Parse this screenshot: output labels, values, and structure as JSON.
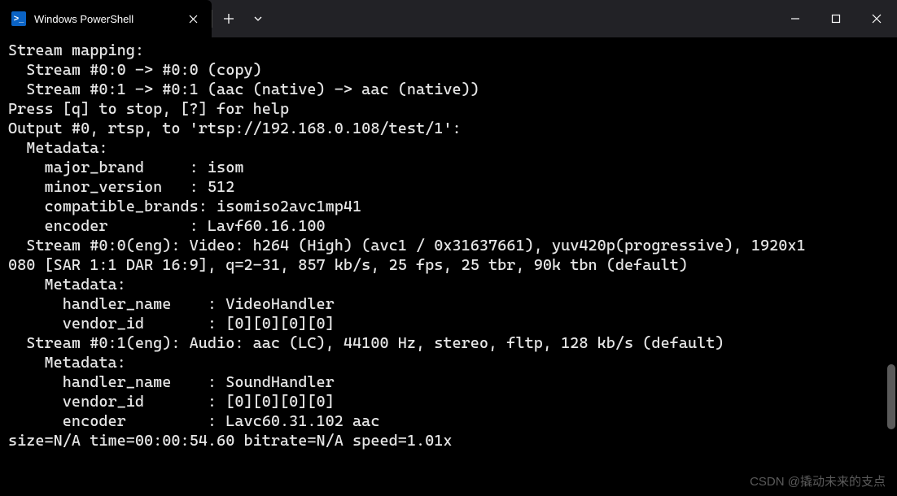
{
  "titlebar": {
    "tab_title": "Windows PowerShell",
    "ps_glyph": ">_"
  },
  "terminal": {
    "lines": [
      "Stream mapping:",
      "  Stream #0:0 -> #0:0 (copy)",
      "  Stream #0:1 -> #0:1 (aac (native) -> aac (native))",
      "Press [q] to stop, [?] for help",
      "Output #0, rtsp, to 'rtsp://192.168.0.108/test/1':",
      "  Metadata:",
      "    major_brand     : isom",
      "    minor_version   : 512",
      "    compatible_brands: isomiso2avc1mp41",
      "    encoder         : Lavf60.16.100",
      "  Stream #0:0(eng): Video: h264 (High) (avc1 / 0x31637661), yuv420p(progressive), 1920x1",
      "080 [SAR 1:1 DAR 16:9], q=2-31, 857 kb/s, 25 fps, 25 tbr, 90k tbn (default)",
      "    Metadata:",
      "      handler_name    : VideoHandler",
      "      vendor_id       : [0][0][0][0]",
      "  Stream #0:1(eng): Audio: aac (LC), 44100 Hz, stereo, fltp, 128 kb/s (default)",
      "    Metadata:",
      "      handler_name    : SoundHandler",
      "      vendor_id       : [0][0][0][0]",
      "      encoder         : Lavc60.31.102 aac",
      "size=N/A time=00:00:54.60 bitrate=N/A speed=1.01x"
    ]
  },
  "watermark": "CSDN @撬动未来的支点"
}
